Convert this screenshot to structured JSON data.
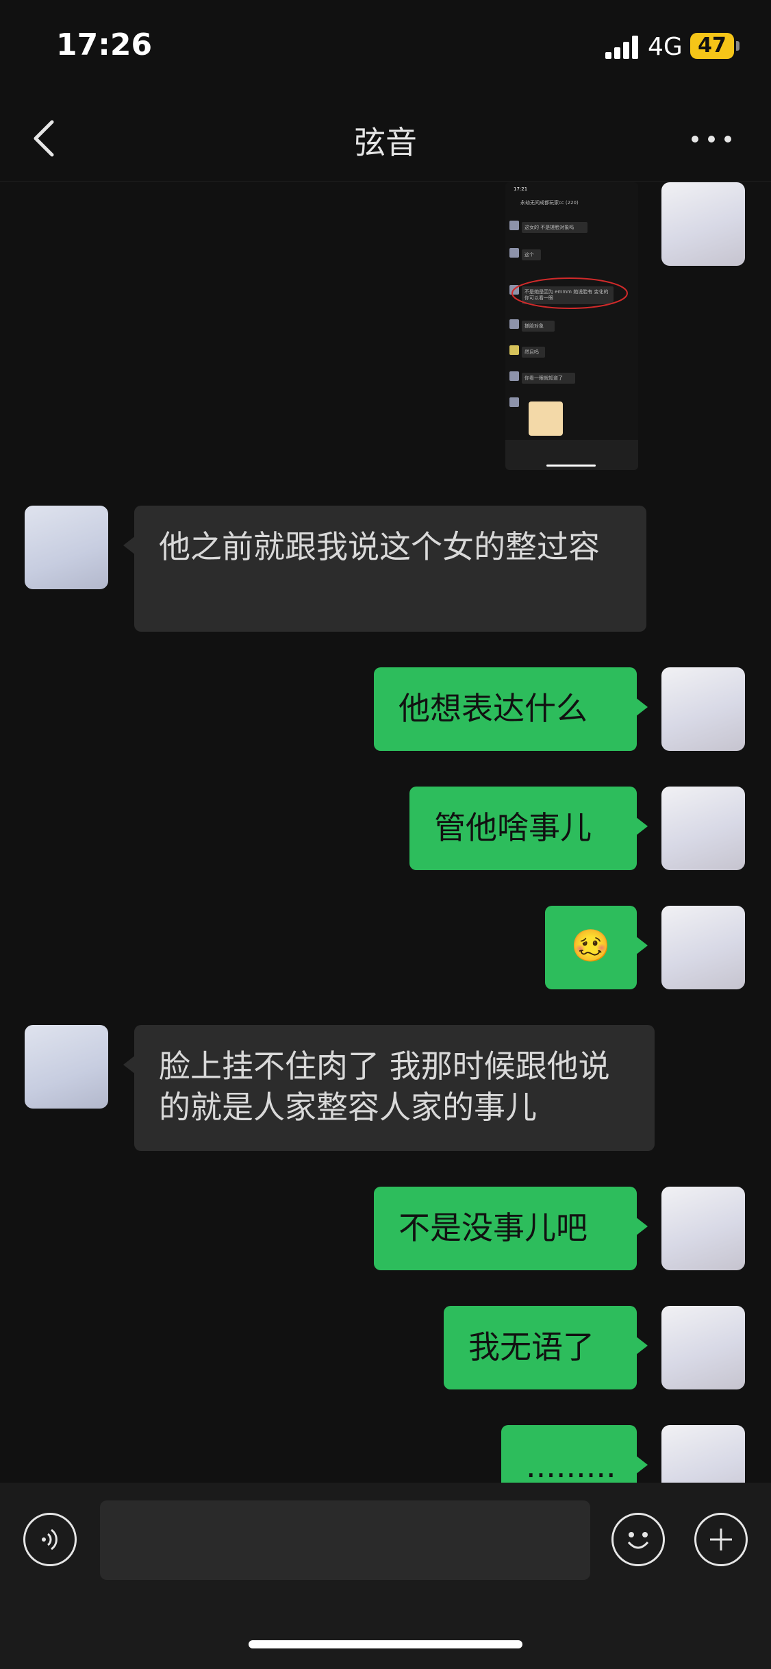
{
  "status_bar": {
    "time": "17:26",
    "network": "4G",
    "battery": "47"
  },
  "header": {
    "title": "弦音"
  },
  "image_message": {
    "time": "17:21",
    "group_title": "永劫无间成都玩家cc (220)",
    "lines": [
      "这女的 不是搓脸对象吗",
      "这个",
      "不是她是因为 emmm 她说脸有 变化的 你可以看一眼",
      "搓脸对象",
      "然且吗",
      "你看一眼就知道了"
    ]
  },
  "messages": [
    {
      "side": "right",
      "type": "image"
    },
    {
      "side": "left",
      "text": "他之前就跟我说这个女的整过容"
    },
    {
      "side": "right",
      "text": "他想表达什么"
    },
    {
      "side": "right",
      "text": "管他啥事儿"
    },
    {
      "side": "right",
      "text": "🥴",
      "emoji_name": "woozy-face"
    },
    {
      "side": "left",
      "text": "脸上挂不住肉了 我那时候跟他说的就是人家整容人家的事儿"
    },
    {
      "side": "right",
      "text": "不是没事儿吧"
    },
    {
      "side": "right",
      "text": "我无语了"
    },
    {
      "side": "right",
      "text": "........."
    }
  ],
  "input_bar": {
    "voice_icon": "voice-icon",
    "emoji_icon": "emoji-icon",
    "plus_icon": "plus-icon",
    "text_value": ""
  },
  "colors": {
    "self_bubble": "#2dbd5c",
    "other_bubble": "#2c2c2c",
    "background": "#111111"
  }
}
